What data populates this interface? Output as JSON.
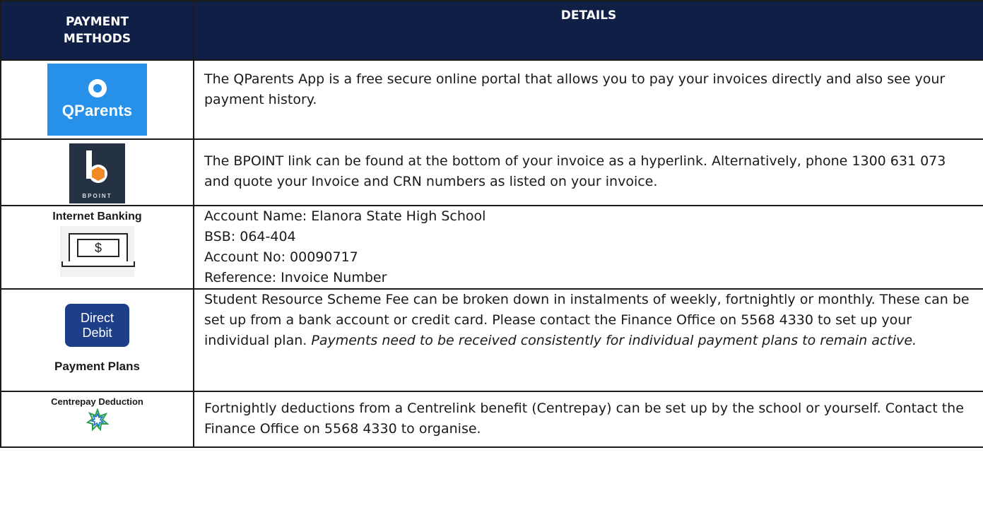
{
  "header": {
    "methods": "PAYMENT METHODS",
    "details": "DETAILS"
  },
  "rows": {
    "qparents": {
      "logo_text": "QParents",
      "details": "The QParents App is a free secure online portal that allows you to pay your invoices directly and also see your payment history."
    },
    "bpoint": {
      "logo_text": "BPOINT",
      "details": "The BPOINT link can be found at the bottom of your invoice as a hyperlink. Alternatively, phone 1300 631 073 and quote your Invoice and CRN numbers as listed on your invoice."
    },
    "internet_banking": {
      "title": "Internet Banking",
      "symbol": "$",
      "lines": [
        "Account Name: Elanora State High School",
        "BSB: 064-404",
        "Account No: 00090717",
        "Reference: Invoice Number"
      ]
    },
    "direct_debit": {
      "logo_line1": "Direct",
      "logo_line2": "Debit",
      "caption": "Payment Plans",
      "details": "Student Resource Scheme Fee can be broken down in instalments of weekly, fortnightly or monthly. These can be set up from a bank account or credit card. Please contact the Finance Office on 5568 4330 to set up your individual plan.",
      "details_italic": "Payments need to be received consistently for individual payment plans to remain active."
    },
    "centrepay": {
      "title": "Centrepay Deduction",
      "details": "Fortnightly deductions from a Centrelink benefit (Centrepay) can be set up by the school or yourself. Contact the Finance Office on 5568 4330 to organise."
    }
  },
  "colors": {
    "header_bg": "#0f1f45",
    "qparents_blue": "#2790e8",
    "bpoint_dark": "#243244",
    "bpoint_orange": "#f08a24",
    "direct_debit_blue": "#1d3f87"
  },
  "icons": [
    "qparents-logo",
    "bpoint-logo",
    "laptop-dollar-icon",
    "direct-debit-logo",
    "centrepay-star-icon"
  ]
}
